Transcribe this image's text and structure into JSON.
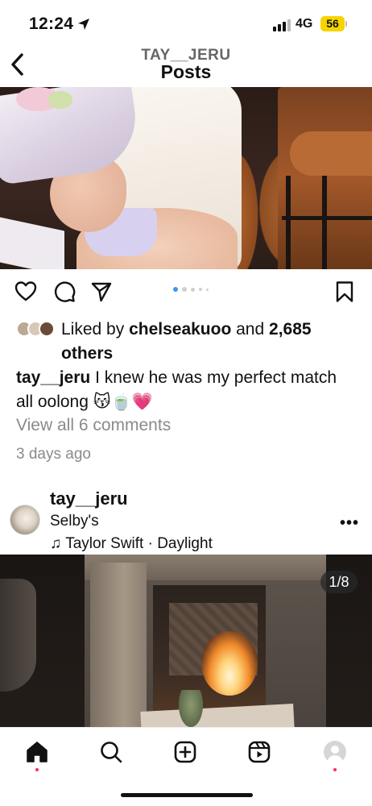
{
  "status_bar": {
    "time": "12:24",
    "network": "4G",
    "battery": "56"
  },
  "header": {
    "username": "TAY__JERU",
    "title": "Posts"
  },
  "post1": {
    "liked_prefix": "Liked by ",
    "liked_user": "chelseakuoo",
    "liked_mid": " and ",
    "liked_count": "2,685 others",
    "caption_user": "tay__jeru",
    "caption_text": " I knew he was my perfect match all oolong 😽🍵💗",
    "view_comments": "View all 6 comments",
    "time_ago": "3 days ago",
    "carousel_total": 5,
    "carousel_active": 1
  },
  "post2": {
    "username": "tay__jeru",
    "location": "Selby's",
    "music_icon": "♫",
    "music": "Taylor Swift · Daylight",
    "more": "•••",
    "counter": "1/8"
  },
  "colors": {
    "carousel_active": "#3897f0",
    "notification_dot": "#ff2b55",
    "battery": "#f7d400"
  },
  "icons": [
    "location-arrow-icon",
    "back-chevron-icon",
    "heart-icon",
    "comment-icon",
    "share-icon",
    "bookmark-icon",
    "home-icon",
    "search-icon",
    "create-icon",
    "reels-icon",
    "profile-icon"
  ]
}
